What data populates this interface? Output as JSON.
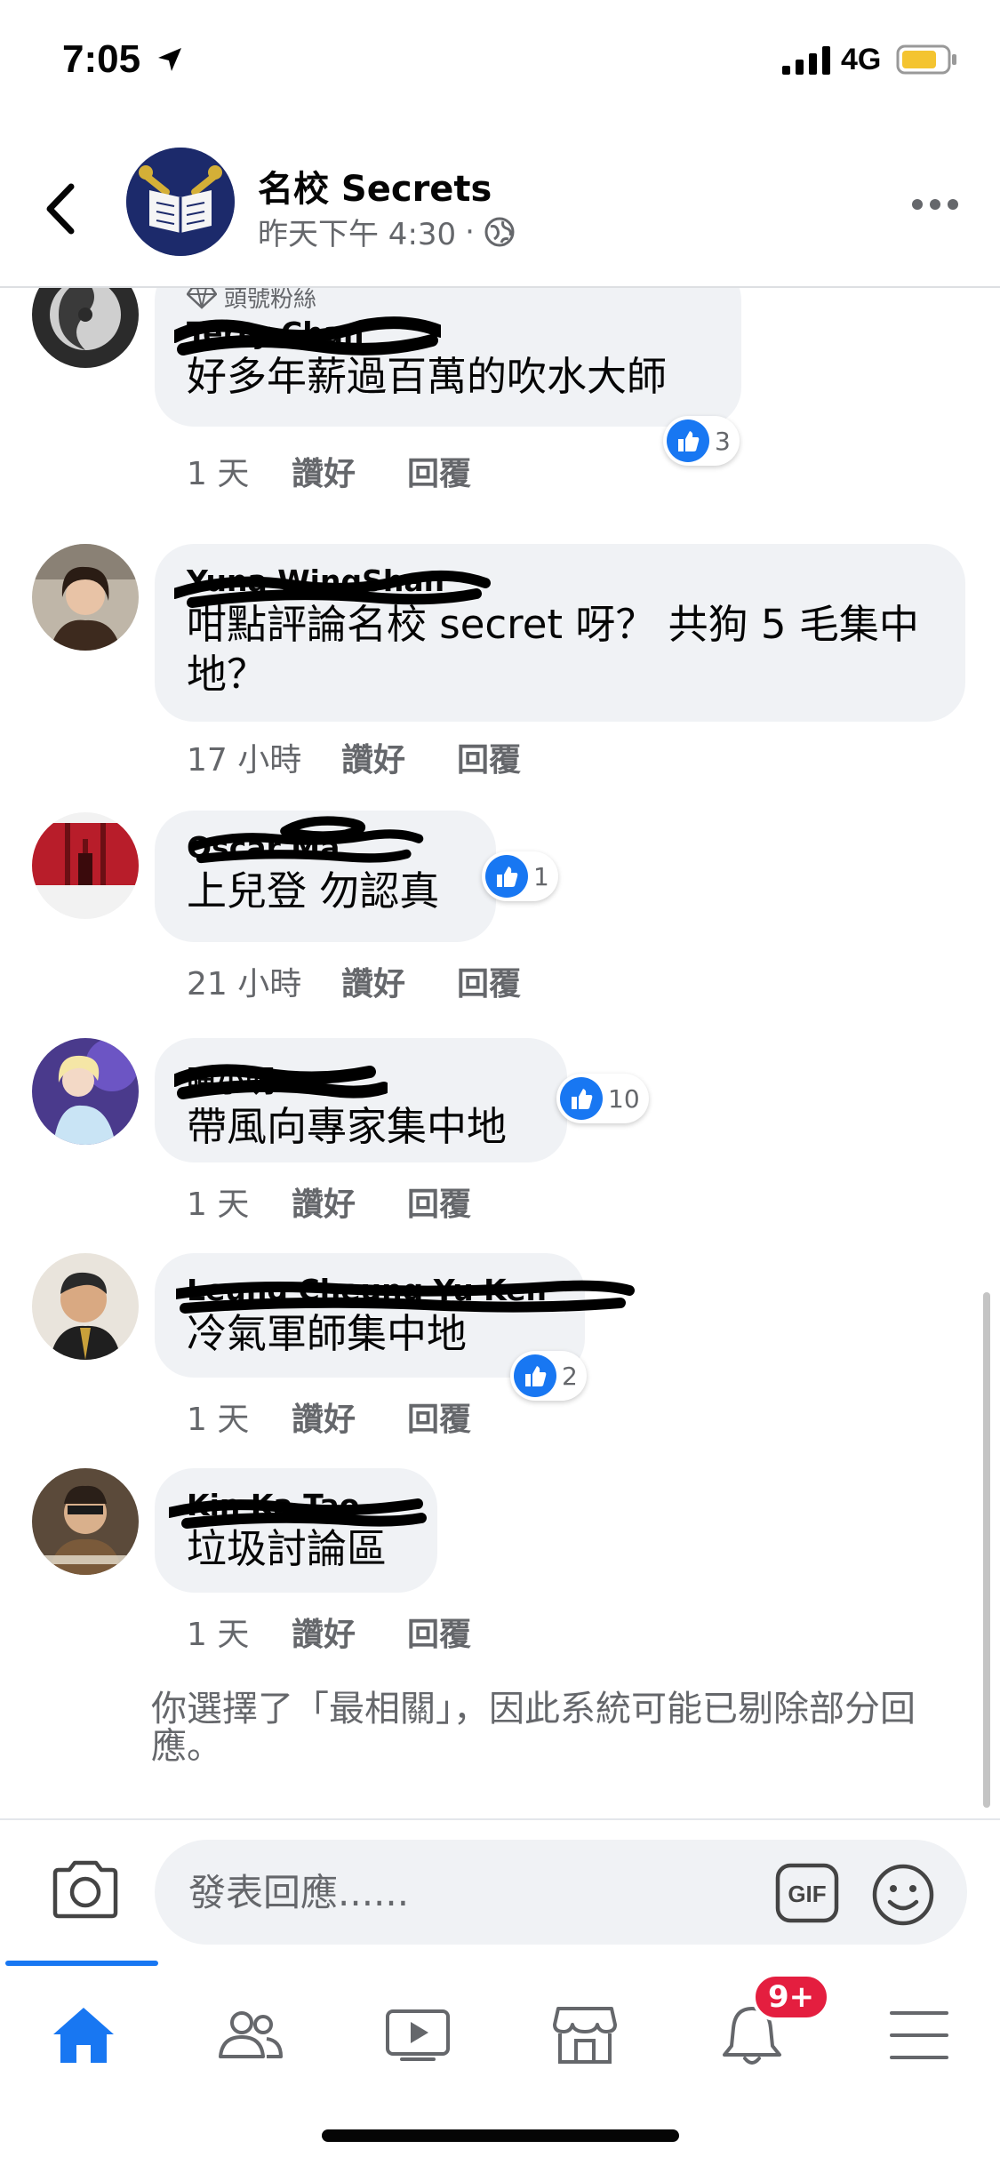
{
  "status_bar": {
    "time": "7:05",
    "network": "4G"
  },
  "header": {
    "group_name": "名校 Secrets",
    "post_time": "昨天下午 4:30",
    "separator": "·"
  },
  "comments": [
    {
      "badge": "頭號粉絲",
      "name": "Terry Chan",
      "text": "好多年薪過百萬的吹水大師",
      "time": "1 天",
      "like": "讚好",
      "reply": "回覆",
      "reactions": "3"
    },
    {
      "name": "Yuna WingShan",
      "text": "咁點評論名校 secret 呀？ 共狗 5 毛集中地？",
      "time": "17 小時",
      "like": "讚好",
      "reply": "回覆",
      "reactions": ""
    },
    {
      "name": "Oscar Ma",
      "text": "上兒登 勿認真",
      "time": "21 小時",
      "like": "讚好",
      "reply": "回覆",
      "reactions": "1"
    },
    {
      "name": "陳小明",
      "text": "帶風向專家集中地",
      "time": "1 天",
      "like": "讚好",
      "reply": "回覆",
      "reactions": "10"
    },
    {
      "name": "Leung Cheung Yu Ken",
      "text": "冷氣軍師集中地",
      "time": "1 天",
      "like": "讚好",
      "reply": "回覆",
      "reactions": "2"
    },
    {
      "name": "Kin Ka Tao",
      "text": "垃圾討論區",
      "time": "1 天",
      "like": "讚好",
      "reply": "回覆",
      "reactions": ""
    }
  ],
  "filter_note": "你選擇了「最相關」，因此系統可能已剔除部分回應。",
  "composer": {
    "placeholder": "發表回應......",
    "gif_label": "GIF"
  },
  "tabbar": {
    "notifications_badge": "9+",
    "active_tab": "home"
  },
  "colors": {
    "accent": "#1877f2",
    "bubble": "#f0f2f5",
    "badge_red": "#e41e3f",
    "muted": "#65676b"
  },
  "icons": [
    "back-arrow-icon",
    "globe-icon",
    "more-icon",
    "like-icon",
    "camera-icon",
    "gif-icon",
    "emoji-icon",
    "home-icon",
    "friends-icon",
    "watch-icon",
    "marketplace-icon",
    "bell-icon",
    "menu-icon"
  ]
}
